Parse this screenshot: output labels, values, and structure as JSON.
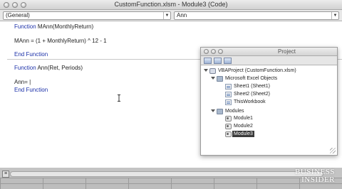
{
  "window": {
    "title": "CustomFunction.xlsm - Module3 (Code)"
  },
  "toolbar": {
    "object_combo": "(General)",
    "procedure_combo": "Ann"
  },
  "code": {
    "fn1_kw": "Function",
    "fn1_sig": " MAnn(MonthlyReturn)",
    "fn1_body": "MAnn = (1 + MonthlyReturn) ^ 12 - 1",
    "fn1_end": "End Function",
    "fn2_kw": "Function",
    "fn2_sig": " Ann(Ret, Periods)",
    "fn2_body": "Ann= |",
    "fn2_end": "End Function"
  },
  "project_window": {
    "title": "Project",
    "root": "VBAProject (CustomFunction.xlsm)",
    "excel_objects_folder": "Microsoft Excel Objects",
    "sheet1": "Sheet1 (Sheet1)",
    "sheet2": "Sheet2 (Sheet2)",
    "workbook": "ThisWorkbook",
    "modules_folder": "Modules",
    "module1": "Module1",
    "module2": "Module2",
    "module3": "Module3",
    "selected": "Module3"
  },
  "watermark": {
    "line1": "BUSINESS",
    "line2": "INSIDER"
  }
}
